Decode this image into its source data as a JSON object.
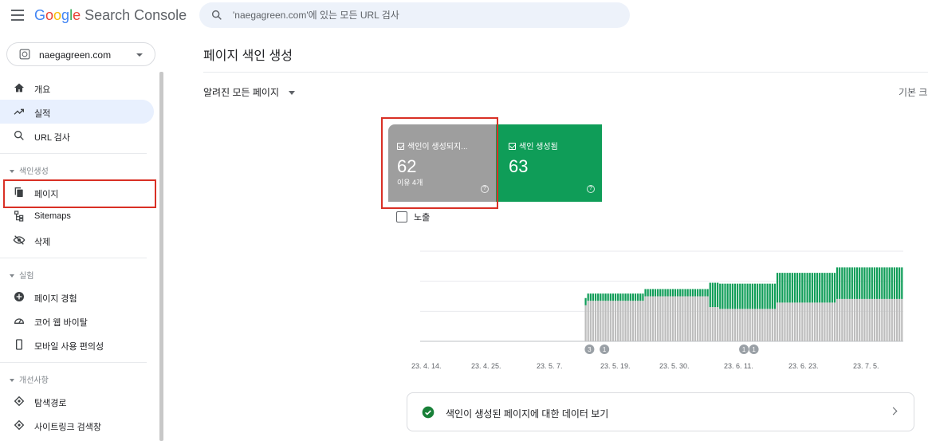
{
  "header": {
    "logo_parts": [
      "G",
      "o",
      "o",
      "g",
      "l",
      "e"
    ],
    "product": "Search Console",
    "search_placeholder": "'naegagreen.com'에 있는 모든 URL 검사"
  },
  "property": {
    "name": "naegagreen.com"
  },
  "sidebar": {
    "items": [
      {
        "label": "개요",
        "icon": "home-icon"
      },
      {
        "label": "실적",
        "icon": "trending-up-icon"
      },
      {
        "label": "URL 검사",
        "icon": "search-icon"
      }
    ],
    "indexing": {
      "title": "색인생성",
      "items": [
        {
          "label": "페이지",
          "icon": "pages-icon"
        },
        {
          "label": "Sitemaps",
          "icon": "sitemap-icon"
        },
        {
          "label": "삭제",
          "icon": "eye-off-icon"
        }
      ]
    },
    "experience": {
      "title": "실험",
      "items": [
        {
          "label": "페이지 경험",
          "icon": "plus-circle-icon"
        },
        {
          "label": "코어 웹 바이탈",
          "icon": "speed-icon"
        },
        {
          "label": "모바일 사용 편의성",
          "icon": "phone-icon"
        }
      ]
    },
    "enhancements": {
      "title": "개선사항",
      "items": [
        {
          "label": "탐색경로",
          "icon": "diamond-icon"
        },
        {
          "label": "사이트링크 검색창",
          "icon": "diamond-icon"
        }
      ]
    }
  },
  "main": {
    "page_title": "페이지 색인 생성",
    "filter_label": "알려진 모든 페이지",
    "right_label": "기본 크",
    "cards": [
      {
        "label": "색인이 생성되지...",
        "value": "62",
        "sub": "이유 4개",
        "color": "#9e9e9e"
      },
      {
        "label": "색인 생성됨",
        "value": "63",
        "color": "#0f9d58"
      }
    ],
    "impressions_label": "노출",
    "data_link": "색인이 생성된 페이지에 대한 데이터 보기"
  },
  "chart_data": {
    "type": "bar",
    "stacked": true,
    "x_ticks": [
      "23. 4. 14.",
      "23. 4. 25.",
      "23. 5. 7.",
      "23. 5. 19.",
      "23. 5. 30.",
      "23. 6. 11.",
      "23. 6. 23.",
      "23. 7. 5."
    ],
    "series": [
      {
        "name": "색인이 생성되지...",
        "color": "#bdbdbd",
        "values": [
          0,
          0,
          0,
          0,
          0,
          0,
          0,
          0,
          0,
          0,
          0,
          0,
          0,
          0,
          0,
          0,
          0,
          0,
          0,
          0,
          0,
          0,
          0,
          0,
          0,
          0,
          0,
          0,
          0,
          0,
          0,
          0,
          0,
          0,
          0,
          0,
          0,
          0,
          0,
          0,
          0,
          0,
          0,
          0,
          0,
          0,
          0,
          0,
          0,
          0,
          0,
          0,
          0,
          0,
          0,
          0,
          0,
          0,
          0,
          0,
          0,
          0,
          0,
          0,
          0,
          0,
          40,
          45,
          45,
          45,
          45,
          45,
          45,
          45,
          45,
          45,
          45,
          45,
          45,
          45,
          45,
          45,
          45,
          45,
          45,
          45,
          45,
          45,
          45,
          45,
          50,
          50,
          50,
          50,
          50,
          50,
          50,
          50,
          50,
          50,
          50,
          50,
          50,
          50,
          50,
          50,
          50,
          50,
          50,
          50,
          50,
          50,
          50,
          50,
          50,
          50,
          38,
          38,
          38,
          38,
          36,
          36,
          36,
          36,
          36,
          36,
          36,
          36,
          36,
          36,
          36,
          36,
          36,
          36,
          36,
          36,
          36,
          36,
          36,
          36,
          36,
          36,
          36,
          43,
          43,
          43,
          43,
          43,
          43,
          43,
          43,
          43,
          43,
          43,
          43,
          43,
          43,
          43,
          43,
          43,
          43,
          43,
          43,
          43,
          43,
          43,
          43,
          47,
          47,
          47,
          47,
          47,
          47,
          47,
          47,
          47,
          47,
          47,
          47,
          47,
          47,
          47,
          47,
          47,
          47,
          47,
          47,
          47,
          47,
          47,
          47,
          47,
          47,
          47
        ]
      },
      {
        "name": "색인 생성됨",
        "color": "#0f9d58",
        "values": [
          0,
          0,
          0,
          0,
          0,
          0,
          0,
          0,
          0,
          0,
          0,
          0,
          0,
          0,
          0,
          0,
          0,
          0,
          0,
          0,
          0,
          0,
          0,
          0,
          0,
          0,
          0,
          0,
          0,
          0,
          0,
          0,
          0,
          0,
          0,
          0,
          0,
          0,
          0,
          0,
          0,
          0,
          0,
          0,
          0,
          0,
          0,
          0,
          0,
          0,
          0,
          0,
          0,
          0,
          0,
          0,
          0,
          0,
          0,
          0,
          0,
          0,
          0,
          0,
          0,
          0,
          8,
          8,
          8,
          8,
          8,
          8,
          8,
          8,
          8,
          8,
          8,
          8,
          8,
          8,
          8,
          8,
          8,
          8,
          8,
          8,
          8,
          8,
          8,
          8,
          8,
          8,
          8,
          8,
          8,
          8,
          8,
          8,
          8,
          8,
          8,
          8,
          8,
          8,
          8,
          8,
          8,
          8,
          8,
          8,
          8,
          8,
          8,
          8,
          8,
          8,
          27,
          27,
          27,
          27,
          28,
          28,
          28,
          28,
          28,
          28,
          28,
          28,
          28,
          28,
          28,
          28,
          28,
          28,
          28,
          28,
          28,
          28,
          28,
          28,
          28,
          28,
          28,
          33,
          33,
          33,
          33,
          33,
          33,
          33,
          33,
          33,
          33,
          33,
          33,
          33,
          33,
          33,
          33,
          33,
          33,
          33,
          33,
          33,
          33,
          33,
          33,
          35,
          35,
          35,
          35,
          35,
          35,
          35,
          35,
          35,
          35,
          35,
          35,
          35,
          35,
          35,
          35,
          35,
          35,
          35,
          35,
          35,
          35,
          35,
          35,
          35,
          35,
          35
        ]
      }
    ],
    "ylim": [
      0,
      100
    ],
    "annotations": [
      {
        "label": "3"
      },
      {
        "label": "1"
      },
      {
        "label": "1"
      },
      {
        "label": "1"
      },
      {
        "label": "1"
      }
    ],
    "grid": true
  }
}
